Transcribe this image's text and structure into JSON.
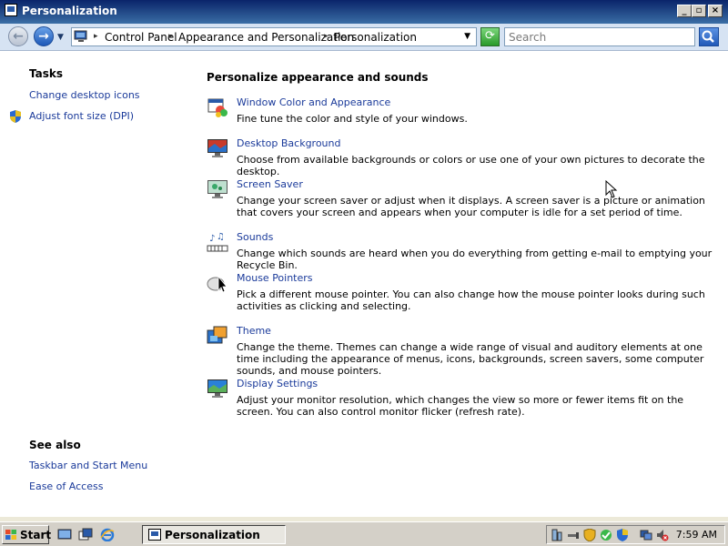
{
  "window": {
    "title": "Personalization"
  },
  "address": {
    "crumbs": [
      "Control Panel",
      "Appearance and Personalization",
      "Personalization"
    ],
    "search_placeholder": "Search"
  },
  "tasks": {
    "heading": "Tasks",
    "items": [
      {
        "label": "Change desktop icons",
        "icon": ""
      },
      {
        "label": "Adjust font size (DPI)",
        "icon": "shield-icon"
      }
    ]
  },
  "see_also": {
    "heading": "See also",
    "items": [
      {
        "label": "Taskbar and Start Menu"
      },
      {
        "label": "Ease of Access"
      }
    ]
  },
  "main": {
    "heading": "Personalize appearance and sounds",
    "items": [
      {
        "label": "Window Color and Appearance",
        "desc": "Fine tune the color and style of your windows.",
        "icon": "window-color-icon"
      },
      {
        "label": "Desktop Background",
        "desc": "Choose from available backgrounds or colors or use one of your own pictures to decorate the desktop.",
        "icon": "desktop-background-icon"
      },
      {
        "label": "Screen Saver",
        "desc": "Change your screen saver or adjust when it displays. A screen saver is a picture or animation that covers your screen and appears when your computer is idle for a set period of time.",
        "icon": "screen-saver-icon"
      },
      {
        "label": "Sounds",
        "desc": "Change which sounds are heard when you do everything from getting e-mail to emptying your Recycle Bin.",
        "icon": "sounds-icon"
      },
      {
        "label": "Mouse Pointers",
        "desc": "Pick a different mouse pointer. You can also change how the mouse pointer looks during such activities as clicking and selecting.",
        "icon": "mouse-pointers-icon"
      },
      {
        "label": "Theme",
        "desc": "Change the theme. Themes can change a wide range of visual and auditory elements at one time including the appearance of menus, icons, backgrounds, screen savers, some computer sounds, and mouse pointers.",
        "icon": "theme-icon"
      },
      {
        "label": "Display Settings",
        "desc": "Adjust your monitor resolution, which changes the view so more or fewer items fit on the screen. You can also control monitor flicker (refresh rate).",
        "icon": "display-settings-icon"
      }
    ]
  },
  "taskbar": {
    "start_label": "Start",
    "window_label": "Personalization",
    "clock": "7:59 AM"
  },
  "colors": {
    "link": "#1a3a9a",
    "titlebar": "#0a246a",
    "address_bg": "#d6e3f3"
  }
}
